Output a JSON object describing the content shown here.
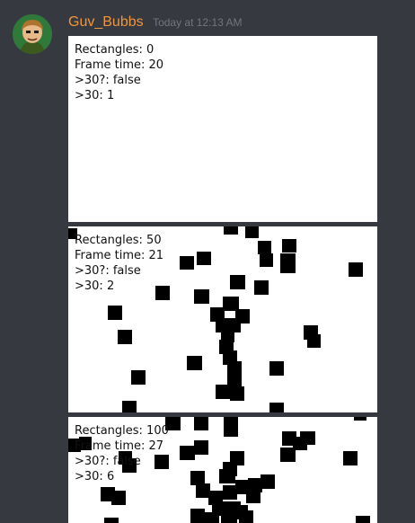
{
  "message": {
    "author": "Guv_Bubbs",
    "timestamp": "Today at 12:13 AM"
  },
  "screenshots": [
    {
      "rectangles": "Rectangles: 0",
      "frame_time": "Frame time: 20",
      "over30": ">30?: false",
      "over30_count": ">30: 1"
    },
    {
      "rectangles": "Rectangles: 50",
      "frame_time": "Frame time: 21",
      "over30": ">30?: false",
      "over30_count": ">30: 2"
    },
    {
      "rectangles": "Rectangles: 100",
      "frame_time": "Frame time: 27",
      "over30": ">30?: false",
      "over30_count": ">30: 6"
    }
  ],
  "colors": {
    "background": "#36393f",
    "username": "#f0963c",
    "timestamp": "#72767d"
  }
}
